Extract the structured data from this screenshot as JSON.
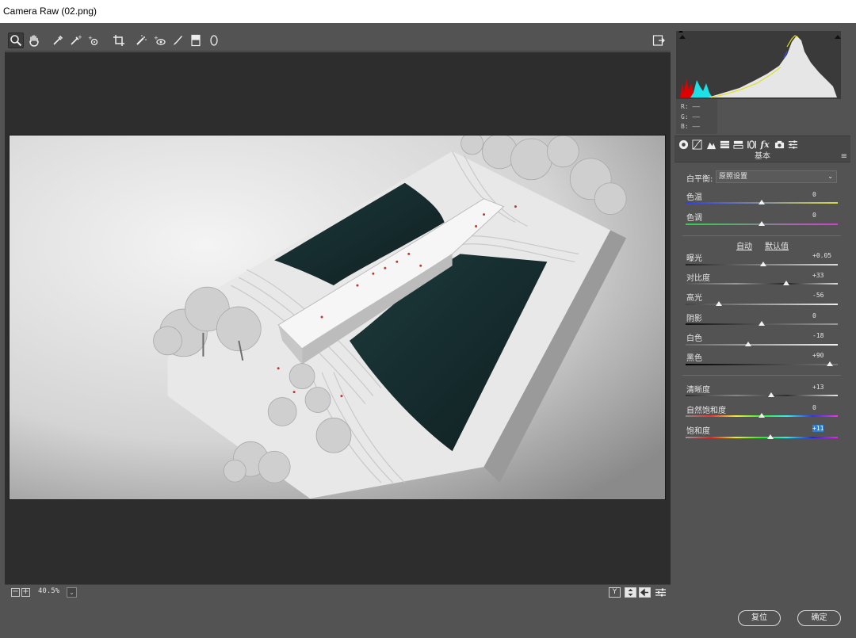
{
  "window": {
    "title": "Camera Raw (02.png)"
  },
  "toolbar": {
    "tools": [
      {
        "name": "zoom-tool",
        "icon": "magnifier-icon"
      },
      {
        "name": "hand-tool",
        "icon": "hand-icon"
      },
      {
        "name": "white-balance-tool",
        "icon": "eyedropper-icon"
      },
      {
        "name": "color-sampler-tool",
        "icon": "color-sampler-icon"
      },
      {
        "name": "targeted-adjustment-tool",
        "icon": "target-adjust-icon"
      },
      {
        "name": "crop-tool",
        "icon": "crop-icon"
      },
      {
        "name": "spot-removal-tool",
        "icon": "spot-removal-icon"
      },
      {
        "name": "red-eye-tool",
        "icon": "red-eye-icon"
      },
      {
        "name": "adjustment-brush-tool",
        "icon": "brush-icon"
      },
      {
        "name": "graduated-filter-tool",
        "icon": "graduated-filter-icon"
      },
      {
        "name": "radial-filter-tool",
        "icon": "radial-filter-icon"
      }
    ],
    "fullscreen_icon": "fullscreen-toggle-icon"
  },
  "status": {
    "zoom_out": "−",
    "zoom_in": "+",
    "zoom_value": "40.5%",
    "dropdown": "⌄",
    "view_y": "Y",
    "icons": [
      "before-after-icon",
      "swap-icon",
      "preferences-icon"
    ]
  },
  "readout": {
    "r": "R:  ——",
    "g": "G:  ——",
    "b": "B:  ——"
  },
  "panel": {
    "title": "基本",
    "menu": "≡",
    "tabs": [
      "basic-icon",
      "tone-curve-icon",
      "detail-icon",
      "hsl-icon",
      "split-toning-icon",
      "lens-icon",
      "effects-icon",
      "camera-calibration-icon",
      "presets-icon"
    ],
    "effects_label": "fx",
    "white_balance": {
      "label": "白平衡:",
      "value": "原照设置"
    },
    "auto": "自动",
    "default": "默认值",
    "sliders": {
      "temp": {
        "label": "色温",
        "value": "0",
        "pos": 0.5
      },
      "tint": {
        "label": "色调",
        "value": "0",
        "pos": 0.5
      },
      "exposure": {
        "label": "曝光",
        "value": "+0.05",
        "pos": 0.51
      },
      "contrast": {
        "label": "对比度",
        "value": "+33",
        "pos": 0.66
      },
      "highlights": {
        "label": "高光",
        "value": "-56",
        "pos": 0.22
      },
      "shadows": {
        "label": "阴影",
        "value": "0",
        "pos": 0.5
      },
      "whites": {
        "label": "白色",
        "value": "-18",
        "pos": 0.41
      },
      "blacks": {
        "label": "黑色",
        "value": "+90",
        "pos": 0.95
      },
      "clarity": {
        "label": "清晰度",
        "value": "+13",
        "pos": 0.565
      },
      "vibrance": {
        "label": "自然饱和度",
        "value": "0",
        "pos": 0.5
      },
      "saturation": {
        "label": "饱和度",
        "value": "+11",
        "pos": 0.555
      }
    }
  },
  "buttons": {
    "reset": "复位",
    "ok": "确定"
  }
}
